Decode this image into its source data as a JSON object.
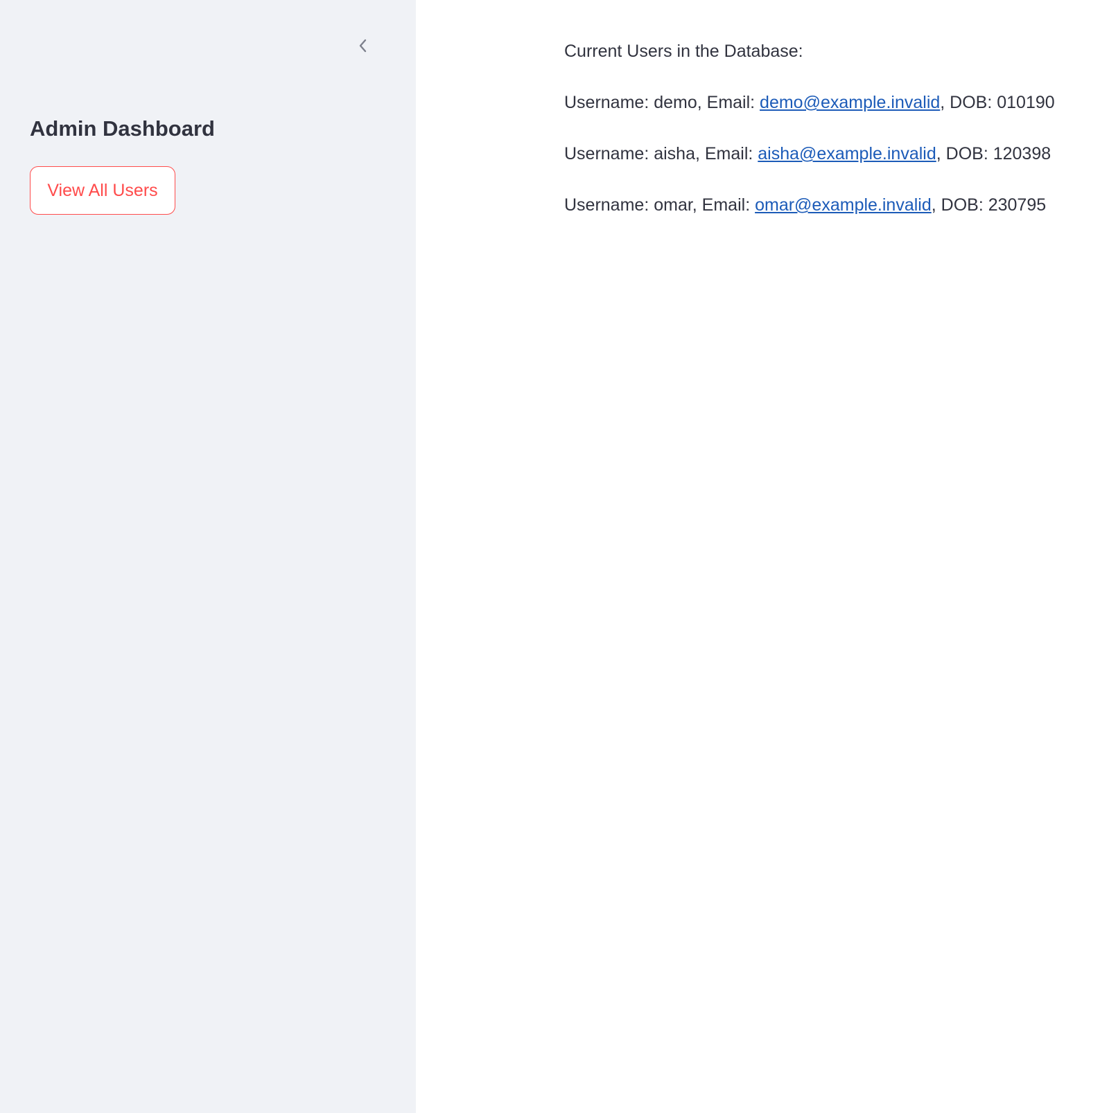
{
  "sidebar": {
    "title": "Admin Dashboard",
    "button_label": "View All Users",
    "collapse_icon": "chevron-left-icon"
  },
  "main": {
    "heading": "Current Users in the Database:",
    "users": [
      {
        "username_prefix": "Username: demo, Email: ",
        "email": "demo@example.invalid",
        "dob_suffix": ", DOB: 010190"
      },
      {
        "username_prefix": "Username: aisha, Email: ",
        "email": "aisha@example.invalid",
        "dob_suffix": ", DOB: 120398"
      },
      {
        "username_prefix": "Username: omar, Email: ",
        "email": "omar@example.invalid",
        "dob_suffix": ", DOB: 230795"
      }
    ]
  },
  "colors": {
    "sidebar_bg": "#f0f2f6",
    "accent": "#ff4b4b",
    "link": "#1c5bb8",
    "text": "#31333f"
  }
}
